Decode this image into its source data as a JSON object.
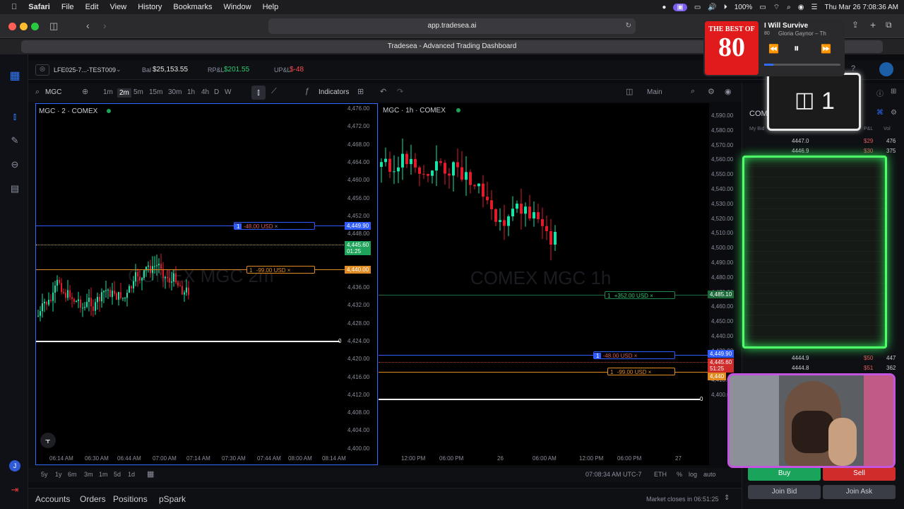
{
  "menubar": {
    "app": "Safari",
    "items": [
      "File",
      "Edit",
      "View",
      "History",
      "Bookmarks",
      "Window",
      "Help"
    ],
    "battery": "100%",
    "datetime": "Thu Mar 26  7:08:36 AM"
  },
  "browser": {
    "url": "app.tradesea.ai",
    "tab_title": "Tradesea - Advanced Trading Dashboard"
  },
  "account": {
    "name": "LFE025-7...-TEST009",
    "bal_label": "Bal",
    "bal": "$25,153.55",
    "rpl_label": "RP&L",
    "rpl": "$201.55",
    "upl_label": "UP&L",
    "upl": "$-48"
  },
  "toolbar": {
    "symbol": "MGC",
    "timeframes": [
      "1m",
      "2m",
      "5m",
      "15m",
      "30m",
      "1h",
      "4h",
      "D",
      "W"
    ],
    "active_tf": "2m",
    "indicators": "Indicators",
    "layout": "Main"
  },
  "left_chart": {
    "title": "MGC · 2 · COMEX",
    "watermark": "COMEX MGC 2m",
    "prices": [
      "4,476.00",
      "4,472.00",
      "4,468.00",
      "4,464.00",
      "4,460.00",
      "4,456.00",
      "4,452.00",
      "4,448.00",
      "4,444.00",
      "4,440.00",
      "4,436.00",
      "4,432.00",
      "4,428.00",
      "4,424.00",
      "4,420.00",
      "4,416.00",
      "4,412.00",
      "4,408.00",
      "4,404.00",
      "4,400.00"
    ],
    "times": [
      "06:14 AM",
      "06:30 AM",
      "06:44 AM",
      "07:00 AM",
      "07:14 AM",
      "07:30 AM",
      "07:44 AM",
      "08:00 AM",
      "08:14 AM"
    ],
    "order1_qty": "1",
    "order1_pl": "-48.00 USD",
    "order1_price": "4,449.90",
    "order2_qty": "1",
    "order2_pl": "-99.00 USD",
    "order2_price": "4,440.00",
    "last_price": "4,445.60",
    "countdown": "01:25",
    "zero": "0"
  },
  "right_chart": {
    "title": "MGC · 1h · COMEX",
    "watermark": "COMEX MGC 1h",
    "prices": [
      "4,590.00",
      "4,580.00",
      "4,570.00",
      "4,560.00",
      "4,550.00",
      "4,540.00",
      "4,530.00",
      "4,520.00",
      "4,510.00",
      "4,500.00",
      "4,490.00",
      "4,480.00",
      "4,470.00",
      "4,460.00",
      "4,450.00",
      "4,440.00",
      "4,430.00",
      "4,420.00",
      "4,410.00",
      "4,400.00"
    ],
    "times": [
      "12:00 PM",
      "06:00 PM",
      "26",
      "06:00 AM",
      "12:00 PM",
      "06:00 PM",
      "27"
    ],
    "tp_qty": "1",
    "tp_pl": "+352.00 USD",
    "tp_price": "4,485.10",
    "order1_qty": "1",
    "order1_pl": "-48.00 USD",
    "order1_price": "4,449.90",
    "order2_qty": "1",
    "order2_pl": "-99.00 USD",
    "order2_price": "4,440",
    "last_price": "4,445.60",
    "countdown": "51:25",
    "zero": "0"
  },
  "timebar": {
    "ranges": [
      "5y",
      "1y",
      "6m",
      "3m",
      "1m",
      "5d",
      "1d"
    ],
    "clock": "07:08:34 AM UTC-7",
    "session": "ETH",
    "pct": "%",
    "log": "log",
    "auto": "auto"
  },
  "bottom": {
    "tabs": [
      "Accounts",
      "Orders",
      "Positions",
      "pSpark"
    ],
    "market": "Market closes in 06:51:25"
  },
  "dom": {
    "title": "COM",
    "headers": [
      "My Bid",
      "P&L",
      "Vol"
    ],
    "rows_top": [
      {
        "price": "4447.0",
        "pl": "$29",
        "vol": "476"
      },
      {
        "price": "4446.9",
        "pl": "$30",
        "vol": "375"
      }
    ],
    "rows_bottom": [
      {
        "price": "4444.9",
        "pl": "$50",
        "vol": "447"
      },
      {
        "price": "4444.8",
        "pl": "$51",
        "vol": "362"
      }
    ],
    "buy": "Buy",
    "sell": "Sell",
    "join_bid": "Join Bid",
    "join_ask": "Join Ask"
  },
  "media": {
    "song": "I Will Survive",
    "artist": "Gloria Gaynor – Th",
    "album_text1": "THE BEST OF",
    "album_text2": "80",
    "album_small": "80"
  },
  "overlay": {
    "count": "1",
    "avatar": "J"
  }
}
